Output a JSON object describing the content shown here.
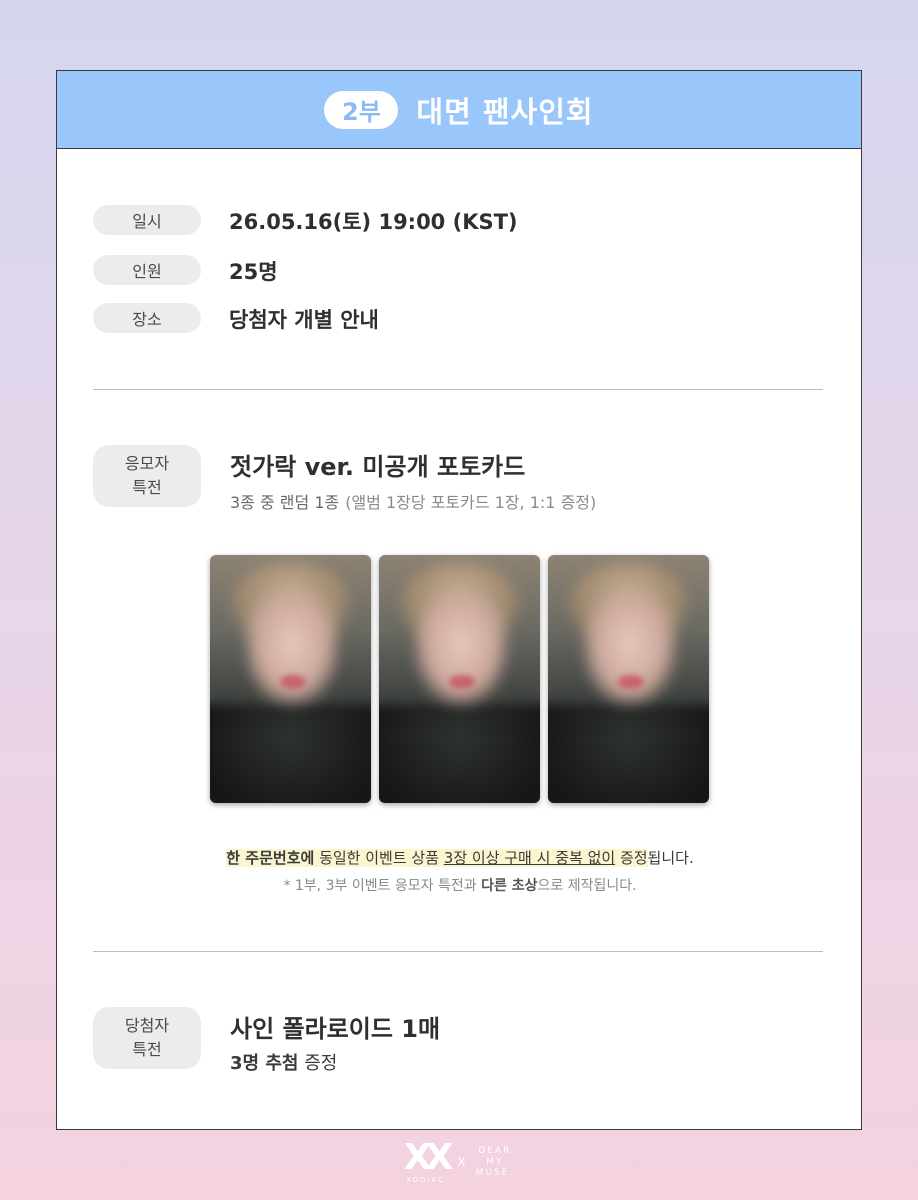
{
  "header": {
    "part": "2부",
    "title": "대면 팬사인회"
  },
  "info": [
    {
      "tag": "일시",
      "value": "26.05.16(토) 19:00 (KST)"
    },
    {
      "tag": "인원",
      "value": "25명"
    },
    {
      "tag": "장소",
      "value": "당첨자 개별 안내"
    }
  ],
  "applicant_benefit": {
    "tag_line1": "응모자",
    "tag_line2": "특전",
    "title": "젓가락 ver. 미공개 포토카드",
    "sub_main": "3종 중 랜덤 1종",
    "sub_note": "(앨범 1장당 포토카드 1장, 1:1 증정)",
    "photo_count": 3
  },
  "notice": {
    "p1_bold": "한 주문번호에",
    "p2": " 동일한 이벤트 상품 ",
    "p3_underline": "3장 이상 구매 시 중복 없이",
    "p4": " 증정",
    "p5": "됩니다.",
    "line2_a": "* 1부, 3부 이벤트 응모자 특전과 ",
    "line2_bold": "다른 초상",
    "line2_b": "으로 제작됩니다."
  },
  "winner_benefit": {
    "tag_line1": "당첨자",
    "tag_line2": "특전",
    "title": "사인 폴라로이드 1매",
    "sub_bold": "3명 추첨",
    "sub_rest": " 증정"
  },
  "footer": {
    "logo_mark": "XX",
    "logo_sub": "XODIAC",
    "separator": "X",
    "brand_line1": "DEAR",
    "brand_line2": "MY",
    "brand_line3": "MUSE."
  },
  "colors": {
    "header_bg": "#99c6fb",
    "pill_text": "#8ab9f5",
    "highlight": "#fbf6cf"
  }
}
